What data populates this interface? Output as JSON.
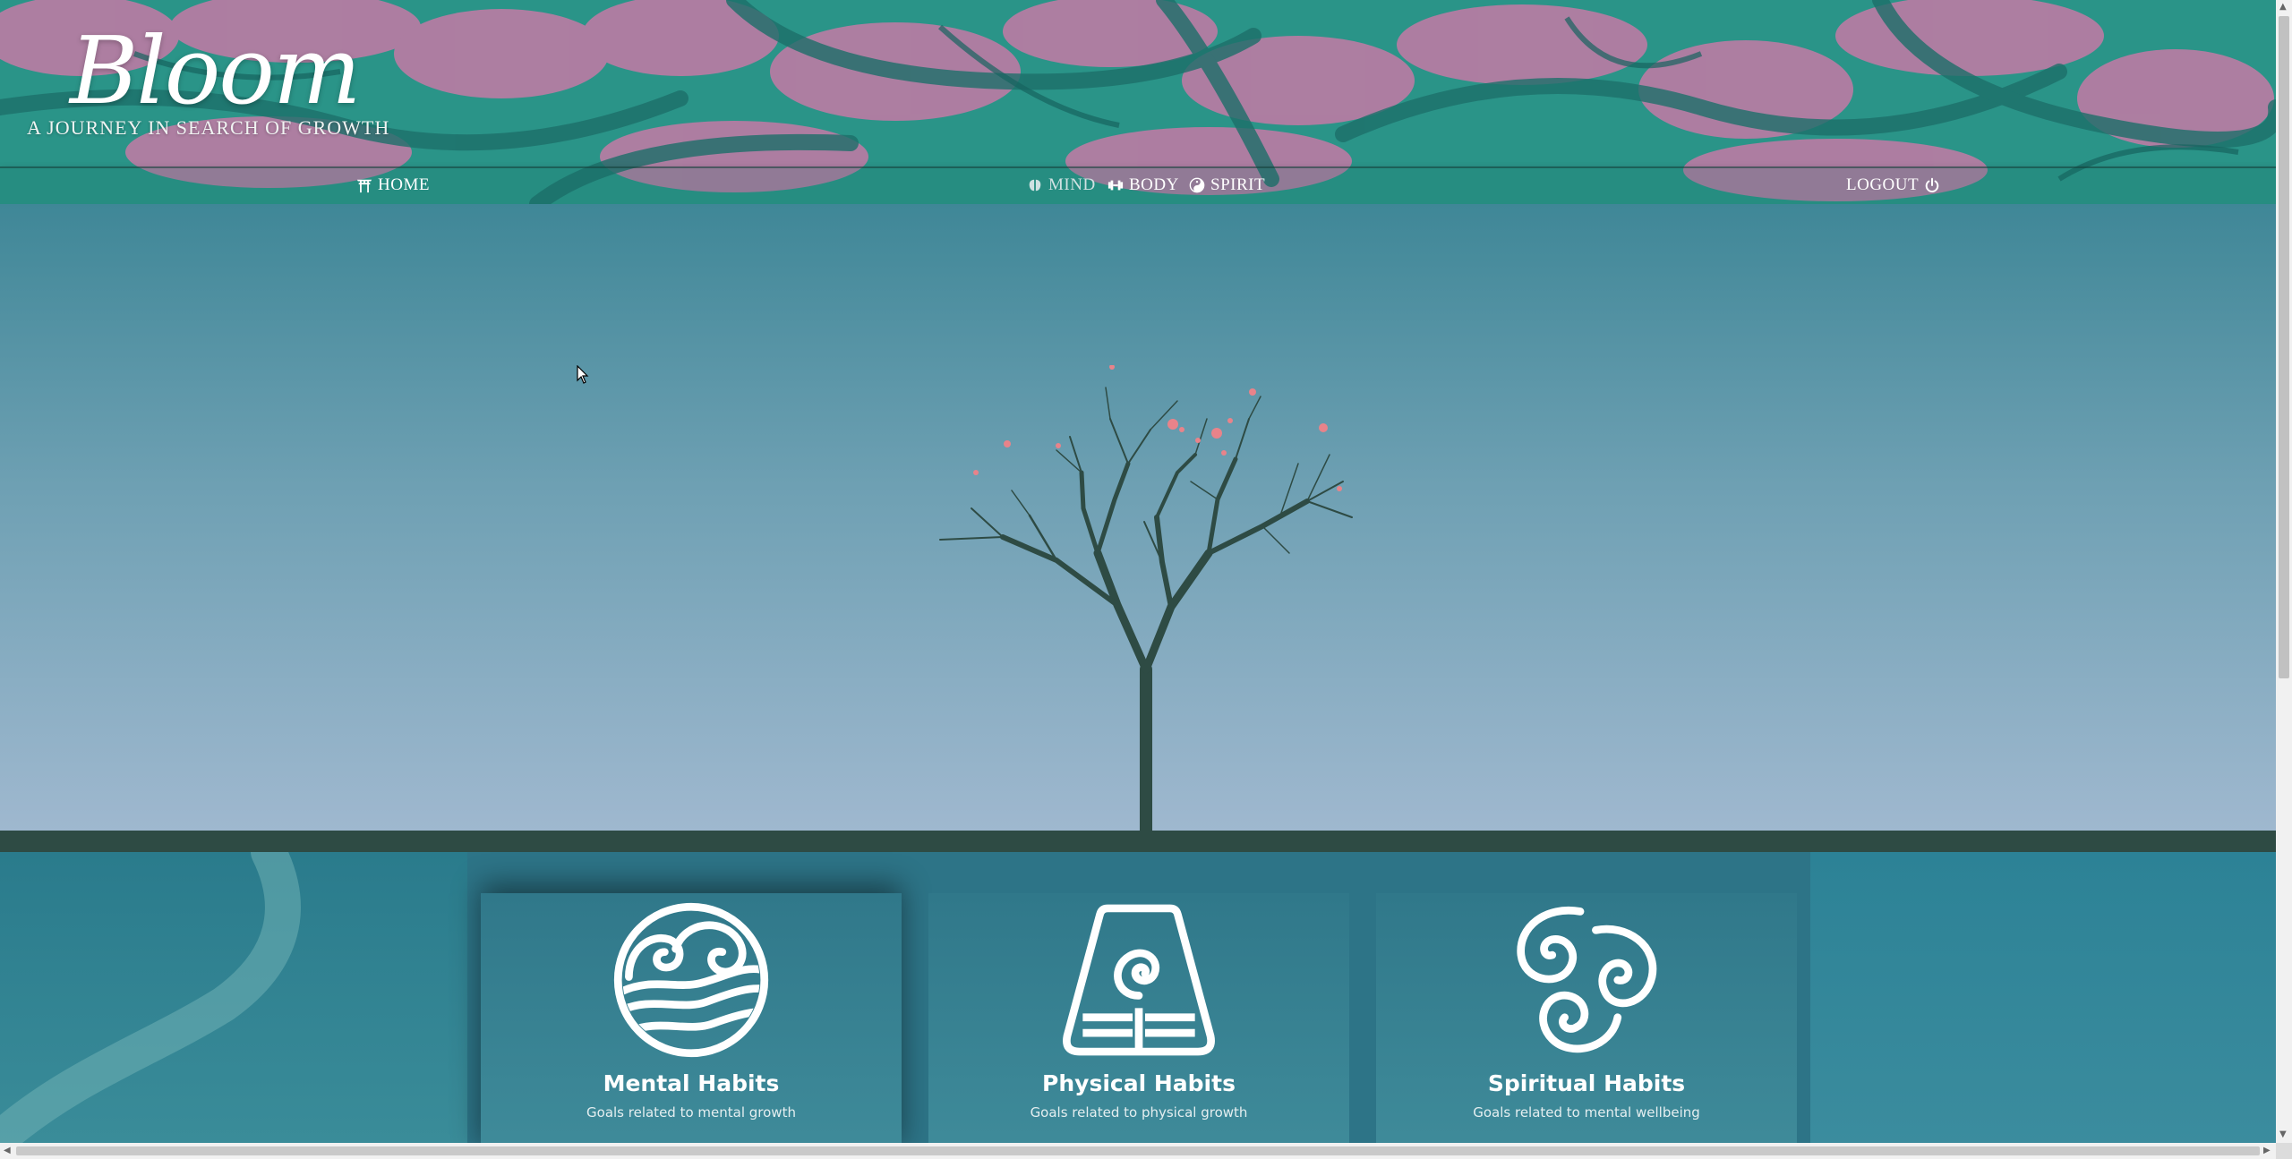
{
  "brand": {
    "title": "Bloom",
    "tagline": "A journey in search of growth"
  },
  "nav": {
    "home": {
      "label": "Home",
      "icon": "torii-gate-icon"
    },
    "mind": {
      "label": "Mind",
      "icon": "brain-icon"
    },
    "body": {
      "label": "Body",
      "icon": "dumbbell-icon"
    },
    "spirit": {
      "label": "Spirit",
      "icon": "yin-yang-icon"
    },
    "logout": {
      "label": "Logout",
      "icon": "power-icon"
    }
  },
  "habits": [
    {
      "title": "Mental Habits",
      "description": "Goals related to mental growth",
      "icon": "water-element-icon"
    },
    {
      "title": "Physical Habits",
      "description": "Goals related to physical growth",
      "icon": "earth-element-icon"
    },
    {
      "title": "Spiritual Habits",
      "description": "Goals related to mental wellbeing",
      "icon": "air-element-icon"
    }
  ],
  "colors": {
    "sky_top": "#3f8797",
    "sky_bottom": "#9fb8cf",
    "tree": "#2e4b44",
    "blossom": "#e8838a",
    "section": "#2d7487"
  }
}
